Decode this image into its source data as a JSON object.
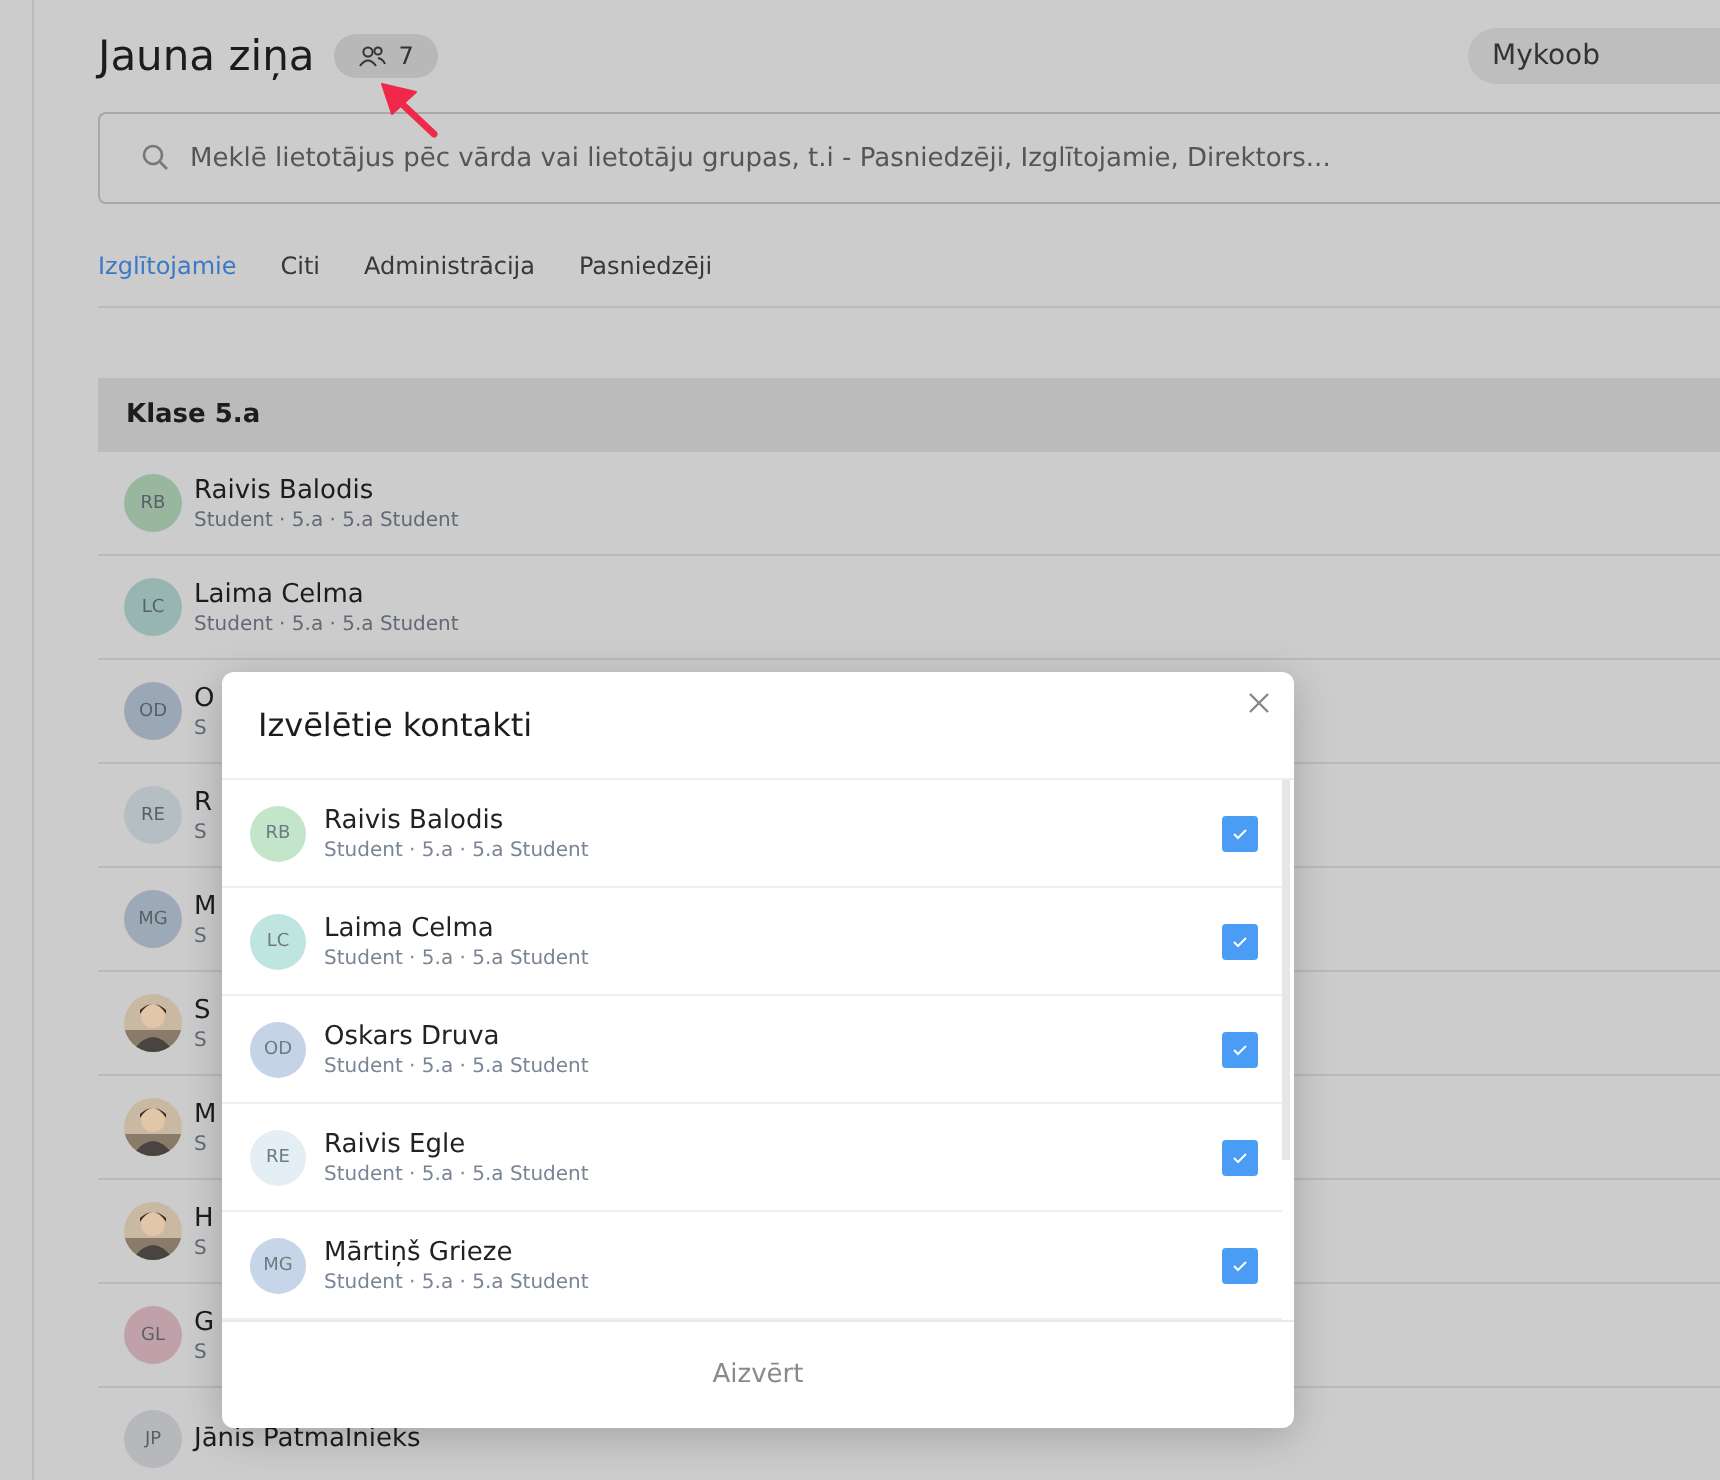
{
  "page": {
    "title": "Jauna ziņa",
    "recipient_count": "7",
    "account": "Mykoob",
    "search": {
      "placeholder": "Meklē lietotājus pēc vārda vai lietotāju grupas, t.i - Pasniedzēji, Izglītojamie, Direktors..."
    },
    "tabs": [
      {
        "label": "Izglītojamie",
        "selected": true
      },
      {
        "label": "Citi",
        "selected": false
      },
      {
        "label": "Administrācija",
        "selected": false
      },
      {
        "label": "Pasniedzēji",
        "selected": false
      }
    ],
    "group": {
      "title": "Klase 5.a",
      "contacts": [
        {
          "kind": "initials",
          "initials": "RB",
          "color": "#99b69e",
          "name": "Raivis Balodis",
          "subtitle": "Student · 5.a · 5.a Student"
        },
        {
          "kind": "initials",
          "initials": "LC",
          "color": "#97b6b1",
          "name": "Laima Celma",
          "subtitle": "Student · 5.a · 5.a Student"
        },
        {
          "kind": "initials",
          "initials": "OD",
          "color": "#9ca7b6",
          "name": "O",
          "subtitle": "S"
        },
        {
          "kind": "initials",
          "initials": "RE",
          "color": "#b5bec2",
          "name": "R",
          "subtitle": "S"
        },
        {
          "kind": "initials",
          "initials": "MG",
          "color": "#9ea9b8",
          "name": "M",
          "subtitle": "S"
        },
        {
          "kind": "picture",
          "name": "S",
          "subtitle": "S"
        },
        {
          "kind": "picture",
          "name": "M",
          "subtitle": "S"
        },
        {
          "kind": "picture",
          "name": "H",
          "subtitle": "S"
        },
        {
          "kind": "initials",
          "initials": "GL",
          "color": "#c0a1a9",
          "name": "G",
          "subtitle": "S"
        },
        {
          "kind": "initials",
          "initials": "JP",
          "color": "#b6b8bb",
          "name": "Jānis Patmalnieks"
        }
      ]
    }
  },
  "dialog": {
    "title": "Izvēlētie kontakti",
    "contacts": [
      {
        "initials": "RB",
        "color": "#c3e6cb",
        "name": "Raivis Balodis",
        "subtitle": "Student · 5.a · 5.a Student",
        "checked": true
      },
      {
        "initials": "LC",
        "color": "#bfe5e0",
        "name": "Laima Celma",
        "subtitle": "Student · 5.a · 5.a Student",
        "checked": true
      },
      {
        "initials": "OD",
        "color": "#c5d3e6",
        "name": "Oskars Druva",
        "subtitle": "Student · 5.a · 5.a Student",
        "checked": true
      },
      {
        "initials": "RE",
        "color": "#e3eef5",
        "name": "Raivis Egle",
        "subtitle": "Student · 5.a · 5.a Student",
        "checked": true
      },
      {
        "initials": "MG",
        "color": "#c7d5e8",
        "name": "Mārtiņš Grieze",
        "subtitle": "Student · 5.a · 5.a Student",
        "checked": true
      }
    ],
    "close_button": "Aizvērt"
  }
}
